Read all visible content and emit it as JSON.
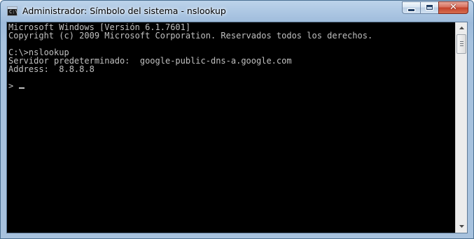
{
  "window": {
    "title": "Administrador: Símbolo del sistema - nslookup",
    "icon": "command-prompt-icon",
    "icon_glyph": "C:\\"
  },
  "caption_buttons": {
    "minimize_icon": "minimize-icon",
    "maximize_icon": "maximize-icon",
    "close_icon": "close-icon",
    "close_glyph": "✕"
  },
  "console": {
    "lines": [
      "Microsoft Windows [Versión 6.1.7601]",
      "Copyright (c) 2009 Microsoft Corporation. Reservados todos los derechos.",
      "",
      "C:\\>nslookup",
      "Servidor predeterminado:  google-public-dns-a.google.com",
      "Address:  8.8.8.8",
      "",
      "> "
    ]
  },
  "scrollbar": {
    "up_icon": "scroll-up-arrow-icon",
    "down_icon": "scroll-down-arrow-icon"
  },
  "colors": {
    "console_background": "#000000",
    "console_text": "#c0c0c0",
    "close_button": "#c4422c"
  }
}
